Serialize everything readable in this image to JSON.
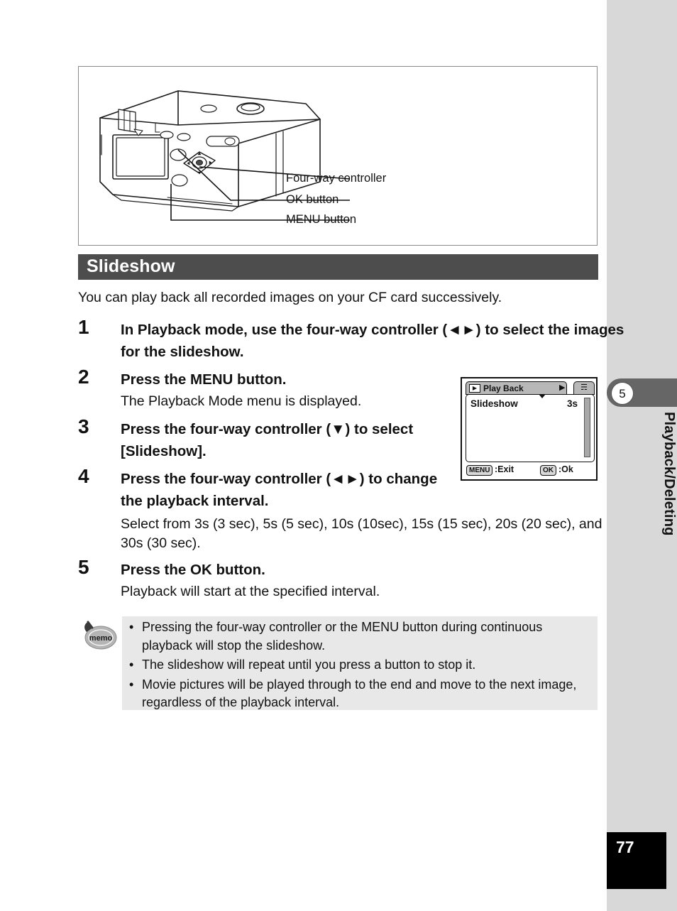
{
  "figure": {
    "callouts": [
      {
        "id": "four-way-controller",
        "label": "Four-way controller"
      },
      {
        "id": "ok-button",
        "label": "OK button"
      },
      {
        "id": "menu-button",
        "label": "MENU button"
      }
    ]
  },
  "section": {
    "title": "Slideshow",
    "bar_color": "#4d4d4d",
    "intro": "You can play back all recorded images on your CF card successively."
  },
  "steps": [
    {
      "number": "1",
      "title": "In Playback mode, use the four-way controller (◄►) to select the images for the slideshow.",
      "description": ""
    },
    {
      "number": "2",
      "title": "Press the MENU button.",
      "description": "The Playback Mode menu is displayed."
    },
    {
      "number": "3",
      "title": "Press the four-way controller (▼) to select [Slideshow].",
      "description": ""
    },
    {
      "number": "4",
      "title": "Press the four-way controller (◄►) to change the playback interval.",
      "description": "Select from 3s (3 sec), 5s (5 sec), 10s (10sec), 15s (15 sec), 20s (20 sec), and 30s (30 sec)."
    },
    {
      "number": "5",
      "title": "Press the OK button.",
      "description": "Playback will start at the specified interval."
    }
  ],
  "lcd": {
    "tab_icon": "▶",
    "tab_label": "Play Back",
    "tab_arrow": "▶",
    "tab_second_icon": "☴",
    "item_label": "Slideshow",
    "item_value": "3s",
    "menu_key": "MENU",
    "menu_action": ":Exit",
    "ok_key": "OK",
    "ok_action": ":Ok"
  },
  "memo": {
    "icon_label": "memo",
    "bullet": "•",
    "items": [
      "Pressing the four-way controller or the MENU button during continuous playback will stop the slideshow.",
      "The slideshow will repeat until you press a button to stop it.",
      "Movie pictures will be played through to the end and move to the next image, regardless of the playback interval."
    ]
  },
  "sidebar": {
    "chapter_number": "5",
    "chapter_label": "Playback/Deleting",
    "page_number": "77",
    "rail_color": "#d8d8d8",
    "tab_color": "#666666"
  }
}
